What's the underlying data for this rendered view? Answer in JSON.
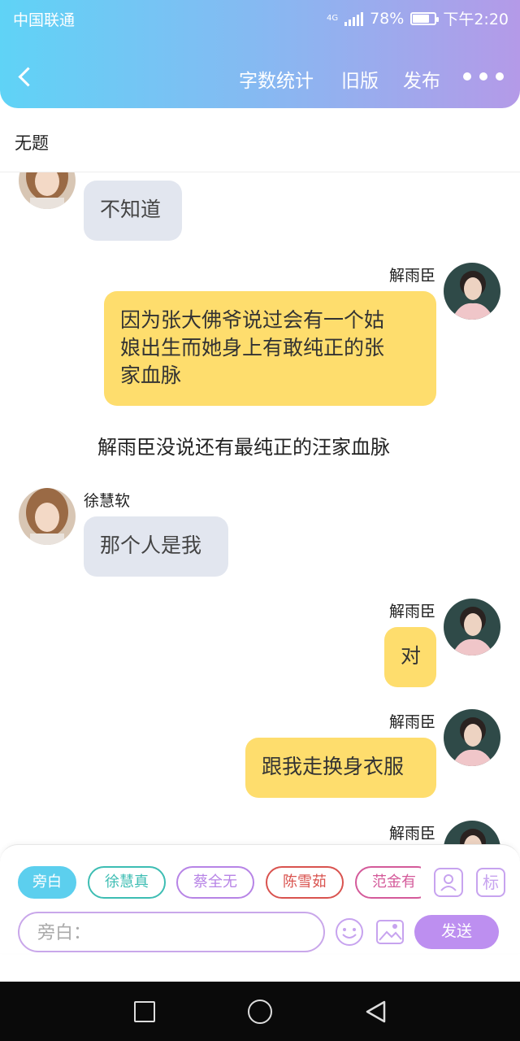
{
  "status_bar": {
    "carrier": "中国联通",
    "network": "4G",
    "battery_percent": "78%",
    "battery_level": 0.78,
    "time": "下午2:20"
  },
  "nav": {
    "word_count": "字数统计",
    "old_version": "旧版",
    "publish": "发布"
  },
  "title": "无题",
  "messages": [
    {
      "side": "left",
      "avatar": "girl-avatar",
      "text": "不知道"
    },
    {
      "side": "right",
      "name": "解雨臣",
      "avatar": "man-avatar",
      "text_lines": [
        "因为张大佛爷说过会有一个姑",
        "娘出生而她身上有敢纯正的张",
        "家血脉"
      ]
    },
    {
      "side": "narration",
      "text": "解雨臣没说还有最纯正的汪家血脉"
    },
    {
      "side": "left",
      "name": "徐慧软",
      "avatar": "girl-avatar",
      "text": "那个人是我"
    },
    {
      "side": "right",
      "name": "解雨臣",
      "avatar": "man-avatar",
      "text": "对"
    },
    {
      "side": "right",
      "name": "解雨臣",
      "avatar": "man-avatar",
      "text": "跟我走换身衣服"
    },
    {
      "side": "right",
      "name": "解雨臣",
      "avatar": "man-avatar",
      "text": ""
    }
  ],
  "panel": {
    "chips": [
      {
        "label": "旁白",
        "color": "#5ccfee",
        "active": true
      },
      {
        "label": "徐慧真",
        "color": "#3dbdb3"
      },
      {
        "label": "蔡全无",
        "color": "#b784e6"
      },
      {
        "label": "陈雪茹",
        "color": "#d9534f"
      },
      {
        "label": "范金有",
        "color": "#d45a9a"
      }
    ],
    "role_icon": "person-card-icon",
    "tag_icon_label": "标",
    "input_placeholder": "旁白：",
    "emoji_icon": "smiley-icon",
    "image_icon": "image-icon",
    "send_label": "发送",
    "accent": "#bd8ff0"
  },
  "system_nav": {
    "icons": [
      "recent-apps-icon",
      "home-icon",
      "back-icon"
    ]
  }
}
